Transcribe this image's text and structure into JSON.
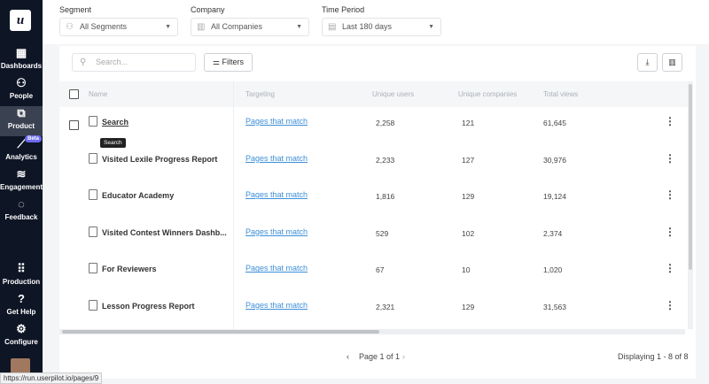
{
  "sidebar": {
    "logo": "u",
    "items": [
      {
        "label": "Dashboards",
        "icon": "dashboard-icon",
        "glyph": "▦"
      },
      {
        "label": "People",
        "icon": "people-icon",
        "glyph": "⚇"
      },
      {
        "label": "Product",
        "icon": "product-icon",
        "glyph": "⧉",
        "active": true
      },
      {
        "label": "Analytics",
        "icon": "analytics-icon",
        "glyph": "⟋",
        "badge": "Beta"
      },
      {
        "label": "Engagement",
        "icon": "layers-icon",
        "glyph": "≋"
      },
      {
        "label": "Feedback",
        "icon": "chat-icon",
        "glyph": "◌"
      },
      {
        "label": "Production",
        "icon": "grid-icon",
        "glyph": "⠿"
      },
      {
        "label": "Get Help",
        "icon": "help-icon",
        "glyph": "?"
      },
      {
        "label": "Configure",
        "icon": "gear-icon",
        "glyph": "⚙"
      }
    ]
  },
  "filters": {
    "segment": {
      "label": "Segment",
      "value": "All Segments"
    },
    "company": {
      "label": "Company",
      "value": "All Companies"
    },
    "period": {
      "label": "Time Period",
      "value": "Last 180 days"
    }
  },
  "toolbar": {
    "search_placeholder": "Search...",
    "filters_label": "Filters"
  },
  "table": {
    "columns": [
      "Name",
      "Targeting",
      "Unique users",
      "Unique companies",
      "Total views"
    ],
    "rows": [
      {
        "name": "Search",
        "targeting": "Pages that match",
        "users": "2,258",
        "companies": "121",
        "views": "61,645"
      },
      {
        "name": "Visited Lexile Progress Report",
        "targeting": "Pages that match",
        "users": "2,233",
        "companies": "127",
        "views": "30,976"
      },
      {
        "name": "Educator Academy",
        "targeting": "Pages that match",
        "users": "1,816",
        "companies": "129",
        "views": "19,124"
      },
      {
        "name": "Visited Contest Winners Dashb...",
        "targeting": "Pages that match",
        "users": "529",
        "companies": "102",
        "views": "2,374"
      },
      {
        "name": "For Reviewers",
        "targeting": "Pages that match",
        "users": "67",
        "companies": "10",
        "views": "1,020"
      },
      {
        "name": "Lesson Progress Report",
        "targeting": "Pages that match",
        "users": "2,321",
        "companies": "129",
        "views": "31,563"
      }
    ]
  },
  "tooltip": "Search",
  "pagination": {
    "page": "Page 1 of 1",
    "displaying": "Displaying 1 - 8 of 8"
  },
  "status_url": "https://run.userpilot.io/pages/9"
}
